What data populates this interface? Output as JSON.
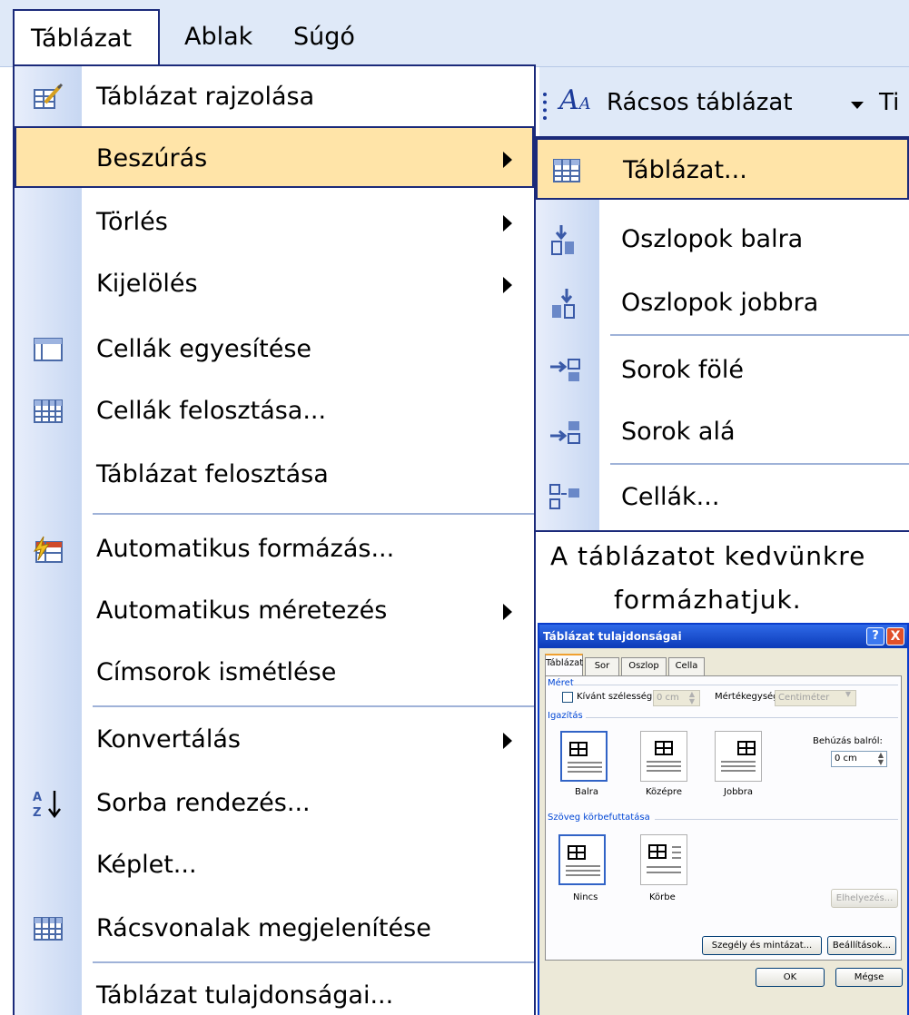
{
  "menubar": {
    "items": [
      "Táblázat",
      "Ablak",
      "Súgó"
    ]
  },
  "main_menu": {
    "items": [
      {
        "label": "Táblázat rajzolása",
        "icon": "draw-table-icon",
        "submenu": false
      },
      {
        "label": "Beszúrás",
        "icon": "",
        "submenu": true,
        "highlighted": true
      },
      {
        "label": "Törlés",
        "icon": "",
        "submenu": true
      },
      {
        "label": "Kijelölés",
        "icon": "",
        "submenu": true
      },
      {
        "label": "Cellák egyesítése",
        "icon": "merge-cells-icon",
        "submenu": false
      },
      {
        "label": "Cellák felosztása...",
        "icon": "split-cells-icon",
        "submenu": false
      },
      {
        "label": "Táblázat felosztása",
        "icon": "",
        "submenu": false
      },
      {
        "label": "Automatikus formázás...",
        "icon": "autoformat-icon",
        "submenu": false
      },
      {
        "label": "Automatikus méretezés",
        "icon": "",
        "submenu": true
      },
      {
        "label": "Címsorok ismétlése",
        "icon": "",
        "submenu": false
      },
      {
        "label": "Konvertálás",
        "icon": "",
        "submenu": true
      },
      {
        "label": "Sorba rendezés...",
        "icon": "sort-az-icon",
        "submenu": false
      },
      {
        "label": "Képlet...",
        "icon": "",
        "submenu": false
      },
      {
        "label": "Rácsvonalak megjelenítése",
        "icon": "gridlines-icon",
        "submenu": false
      },
      {
        "label": "Táblázat tulajdonságai...",
        "icon": "",
        "submenu": false
      }
    ]
  },
  "toolbar": {
    "style_glyph": "A",
    "style_value": "Rácsos táblázat",
    "next_label": "Ti"
  },
  "submenu": {
    "items": [
      {
        "label": "Táblázat...",
        "icon": "insert-table-icon",
        "highlighted": true
      },
      {
        "label": "Oszlopok balra",
        "icon": "insert-columns-left-icon"
      },
      {
        "label": "Oszlopok jobbra",
        "icon": "insert-columns-right-icon"
      },
      {
        "label": "Sorok fölé",
        "icon": "insert-rows-above-icon"
      },
      {
        "label": "Sorok alá",
        "icon": "insert-rows-below-icon"
      },
      {
        "label": "Cellák...",
        "icon": "insert-cells-icon"
      }
    ]
  },
  "caption": {
    "line1": "A táblázatot kedvünkre",
    "line2": "formázhatjuk."
  },
  "dialog": {
    "title": "Táblázat tulajdonságai",
    "help": "?",
    "close": "X",
    "tabs": [
      "Táblázat",
      "Sor",
      "Oszlop",
      "Cella"
    ],
    "size_group": "Méret",
    "preferred_width_label": "Kívánt szélesség:",
    "preferred_width_value": "0 cm",
    "measure_label": "Mértékegység:",
    "measure_value": "Centiméter",
    "alignment_group": "Igazítás",
    "alignment_options": [
      "Balra",
      "Középre",
      "Jobbra"
    ],
    "indent_label": "Behúzás balról:",
    "indent_value": "0 cm",
    "wrapping_group": "Szöveg körbefuttatása",
    "wrapping_options": [
      "Nincs",
      "Körbe"
    ],
    "positioning_button": "Elhelyezés...",
    "borders_button": "Szegély és mintázat...",
    "options_button": "Beállítások...",
    "ok_button": "OK",
    "cancel_button": "Mégse"
  },
  "colors": {
    "menu_highlight": "#ffe4a8",
    "menu_border": "#1b2a7a",
    "menu_gradient": "#c7d7f2",
    "title_bar": "#0b3ab8"
  }
}
